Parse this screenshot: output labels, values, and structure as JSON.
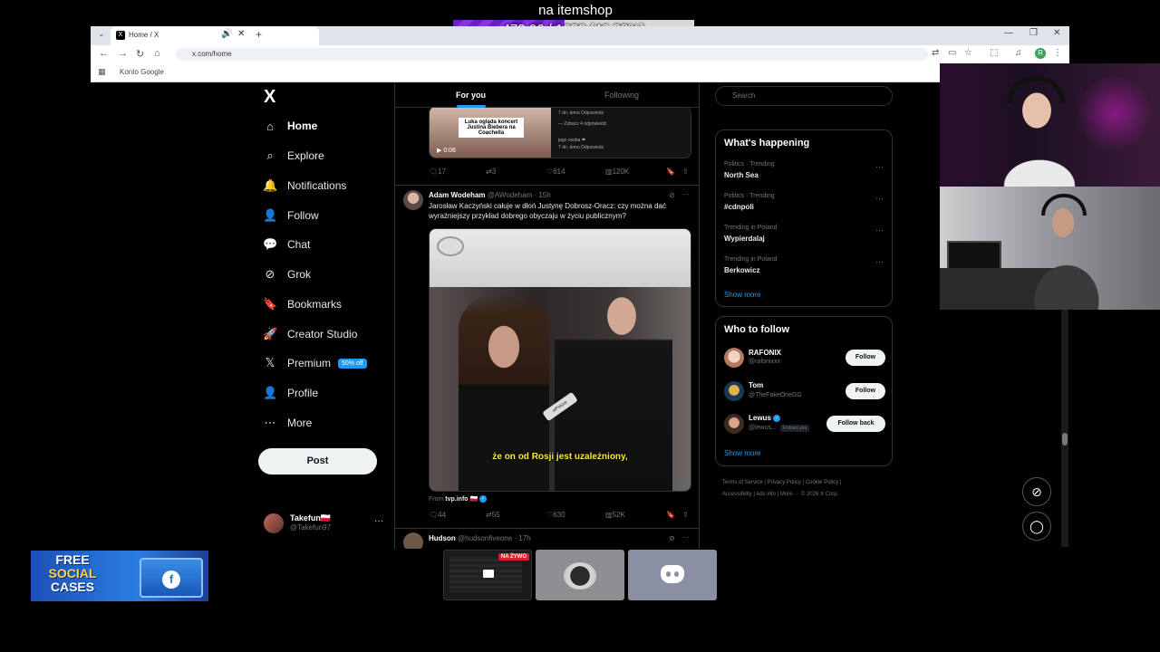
{
  "overlay": {
    "goal_title": "na itemshop",
    "goal_progress": "473.06 / 1020 (46.38%)",
    "goal_fraction": 0.4638
  },
  "browser": {
    "tab_title": "Home / X",
    "tab_favicon": "X",
    "url": "x.com/home",
    "bookmark": "Konto Google",
    "profile_initial": "R"
  },
  "sidebar": {
    "logo": "X",
    "items": [
      {
        "label": "Home",
        "icon": "home-icon",
        "glyph": "⌂"
      },
      {
        "label": "Explore",
        "icon": "search-icon",
        "glyph": "⌕"
      },
      {
        "label": "Notifications",
        "icon": "bell-icon",
        "glyph": "🔔"
      },
      {
        "label": "Follow",
        "icon": "person-plus-icon",
        "glyph": "👤"
      },
      {
        "label": "Chat",
        "icon": "chat-icon",
        "glyph": "💬"
      },
      {
        "label": "Grok",
        "icon": "grok-icon",
        "glyph": "⊘"
      },
      {
        "label": "Bookmarks",
        "icon": "bookmark-icon",
        "glyph": "🔖"
      },
      {
        "label": "Creator Studio",
        "icon": "rocket-icon",
        "glyph": "🚀"
      },
      {
        "label": "Premium",
        "icon": "x-premium-icon",
        "glyph": "𝕏",
        "badge": "50% off"
      },
      {
        "label": "Profile",
        "icon": "person-icon",
        "glyph": "👤"
      },
      {
        "label": "More",
        "icon": "more-circle-icon",
        "glyph": "⋯"
      }
    ],
    "post_label": "Post",
    "account": {
      "name": "Takefun🇵🇱",
      "handle": "@Takefun97",
      "more": "···"
    }
  },
  "feed": {
    "tabs": [
      "For you",
      "Following"
    ],
    "prev_post": {
      "caption": "Luka ogląda koncert Justina Biebera na Coachella",
      "duration": "0:06",
      "side_lines": [
        "7 dn. temu   Odpowiedz",
        "— Zobacz 4 odpowiedzi",
        "jego osoba ❤",
        "7 dn. temu   Odpowiedz"
      ],
      "stats": {
        "replies": "17",
        "reposts": "3",
        "likes": "614",
        "views": "120K"
      }
    },
    "tweet": {
      "name": "Adam Wodeham",
      "handle": "@AWodeham · 15h",
      "text": "Jarosław Kaczyński całuje w dłoń Justynę Dobrosz-Oracz: czy można dać wyraźniejszy przykład dobrego obyczaju w życiu publicznym?",
      "subtitle": "że on od Rosji jest uzależniony,",
      "mic_label": "wPolsce",
      "from_prefix": "From ",
      "from_source": "tvp.info 🇵🇱",
      "stats": {
        "replies": "44",
        "reposts": "55",
        "likes": "630",
        "views": "52K"
      }
    },
    "next_tweet": {
      "name": "Hudson",
      "handle": "@hudsonfiveone · 17h"
    }
  },
  "right": {
    "search_placeholder": "Search",
    "whats_happening": "What's happening",
    "trends": [
      {
        "context": "Politics · Trending",
        "name": "North Sea"
      },
      {
        "context": "Politics · Trending",
        "name": "#cdnpoli"
      },
      {
        "context": "Trending in Poland",
        "name": "Wypierdalaj"
      },
      {
        "context": "Trending in Poland",
        "name": "Berkowicz"
      }
    ],
    "show_more": "Show more",
    "who_to_follow": "Who to follow",
    "follow": [
      {
        "name": "RAFONIX",
        "handle": "@rafonixxx",
        "button": "Follow"
      },
      {
        "name": "Tom",
        "handle": "@TheFakeOneGG",
        "button": "Follow"
      },
      {
        "name": "Lewus",
        "handle": "@lewus...",
        "follows_you": "Follows you",
        "button": "Follow back"
      }
    ],
    "footer": [
      "Terms of Service",
      "Privacy Policy",
      "Cookie Policy",
      "Accessibility",
      "Ads info",
      "More ···",
      "© 2026 X Corp."
    ]
  },
  "promo": {
    "line1": "FREE",
    "line2": "SOCIAL",
    "line3": "CASES",
    "fb": "f"
  },
  "thumbs": {
    "live": "NA ŻYWO"
  },
  "colors": {
    "accent": "#1d9bf0",
    "goal_fill": "#7a29d0",
    "background": "#000000"
  }
}
